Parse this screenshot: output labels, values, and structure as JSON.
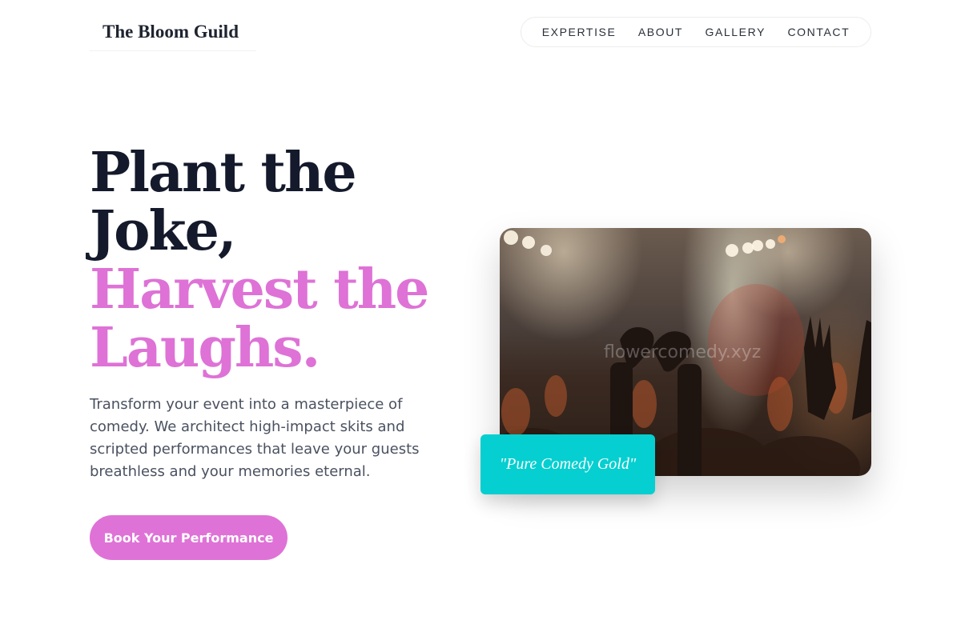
{
  "brand": {
    "name": "The Bloom Guild"
  },
  "nav": {
    "items": [
      {
        "label": "EXPERTISE"
      },
      {
        "label": "ABOUT"
      },
      {
        "label": "GALLERY"
      },
      {
        "label": "CONTACT"
      }
    ]
  },
  "hero": {
    "headline_dark_line1": "Plant the",
    "headline_dark_line2": "Joke,",
    "headline_accent_line1": "Harvest the",
    "headline_accent_line2": "Laughs.",
    "description": "Transform your event into a masterpiece of comedy. We architect high-impact skits and scripted performances that leave your guests breathless and your memories eternal.",
    "cta_label": "Book Your Performance",
    "image_watermark": "flowercomedy.xyz",
    "quote": "\"Pure Comedy Gold\""
  },
  "colors": {
    "accent": "#de72d6",
    "heading": "#141a2b",
    "quote_bg": "#05cfd0",
    "body_text": "#4a5160"
  },
  "icons": {
    "hero_image": "concert-crowd-hands-heart-photo"
  }
}
